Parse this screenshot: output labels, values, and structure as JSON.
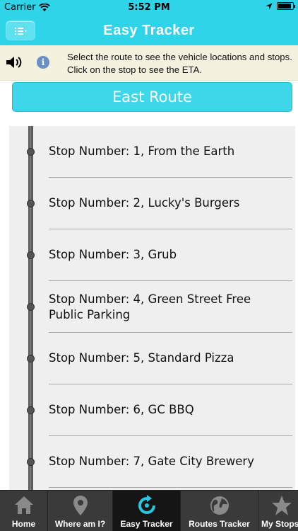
{
  "status_bar": {
    "carrier": "Carrier",
    "time": "5:52 PM"
  },
  "nav": {
    "title": "Easy Tracker",
    "menu_icon": "list-icon"
  },
  "info": {
    "message": "Select the route to see the vehicle locations and stops. Click on the stop to see the ETA.",
    "speaker_icon": "speaker-icon",
    "info_icon": "info-icon"
  },
  "route": {
    "label": "East Route"
  },
  "stops": [
    {
      "label": "Stop Number: 1, From the Earth"
    },
    {
      "label": "Stop Number: 2, Lucky's Burgers"
    },
    {
      "label": "Stop Number: 3, Grub"
    },
    {
      "label": "Stop Number: 4, Green Street Free Public Parking"
    },
    {
      "label": "Stop Number: 5, Standard Pizza"
    },
    {
      "label": "Stop Number: 6, GC BBQ"
    },
    {
      "label": "Stop Number: 7, Gate City Brewery"
    }
  ],
  "tabs": [
    {
      "label": "Home",
      "icon": "home-icon"
    },
    {
      "label": "Where am I?",
      "icon": "map-pin-icon"
    },
    {
      "label": "Easy Tracker",
      "icon": "refresh-icon",
      "active": true
    },
    {
      "label": "Routes Tracker",
      "icon": "globe-icon"
    },
    {
      "label": "My Stops",
      "icon": "star-icon"
    }
  ],
  "colors": {
    "accent": "#2fd4e8",
    "tab_bar": "#3a3a3a",
    "active_tab": "#151515"
  }
}
